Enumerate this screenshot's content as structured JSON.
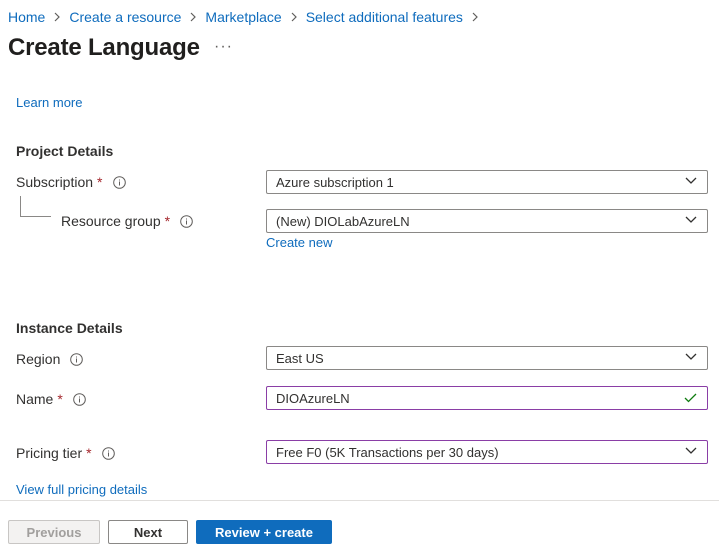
{
  "breadcrumb": [
    "Home",
    "Create a resource",
    "Marketplace",
    "Select additional features"
  ],
  "page": {
    "title": "Create Language",
    "more": "···"
  },
  "learn_more": "Learn more",
  "project": {
    "heading": "Project Details",
    "subscription": {
      "label": "Subscription",
      "required": "*",
      "value": "Azure subscription 1"
    },
    "resource_group": {
      "label": "Resource group",
      "required": "*",
      "value": "(New) DIOLabAzureLN",
      "create_new": "Create new"
    }
  },
  "instance": {
    "heading": "Instance Details",
    "region": {
      "label": "Region",
      "value": "East US"
    },
    "name": {
      "label": "Name",
      "required": "*",
      "value": "DIOAzureLN",
      "valid": true
    },
    "pricing": {
      "label": "Pricing tier",
      "required": "*",
      "value": "Free F0 (5K Transactions per 30 days)"
    },
    "pricing_link": "View full pricing details"
  },
  "footer": {
    "previous": "Previous",
    "next": "Next",
    "review": "Review + create"
  },
  "colors": {
    "link": "#0f6cbd",
    "required": "#a4262c",
    "selected_border": "#8a3ea6",
    "valid_check": "#107c10"
  }
}
